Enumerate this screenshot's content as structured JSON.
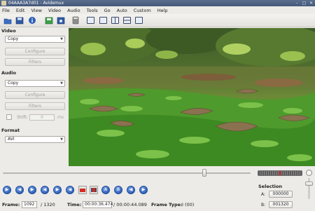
{
  "window": {
    "title": "04AAA3A7d01 - Avidemux",
    "minimize_label": "–",
    "maximize_label": "□",
    "close_label": "✕"
  },
  "menu": [
    "File",
    "Edit",
    "View",
    "Video",
    "Audio",
    "Tools",
    "Go",
    "Auto",
    "Custom",
    "Help"
  ],
  "toolbar": {
    "icons": [
      "open-icon",
      "save-icon",
      "info-icon",
      "save-video-icon",
      "save-audio-icon",
      "calculator-icon",
      "preview-input-icon",
      "preview-output-icon",
      "side-by-side-icon",
      "top-bottom-icon",
      "separate-icon"
    ]
  },
  "video": {
    "section_title": "Video",
    "codec": "Copy",
    "configure_label": "Configure",
    "filters_label": "Filters"
  },
  "audio": {
    "section_title": "Audio",
    "codec": "Copy",
    "configure_label": "Configure",
    "filters_label": "Filters",
    "shift_label": "Shift:",
    "shift_value": "0",
    "shift_unit": "ms"
  },
  "format": {
    "section_title": "Format",
    "value": "AVI"
  },
  "playback": {
    "seek_position": 0.827,
    "controls": [
      {
        "name": "play-icon",
        "glyph": "▶"
      },
      {
        "name": "previous-frame-icon",
        "glyph": "◀"
      },
      {
        "name": "next-frame-icon",
        "glyph": "▶"
      },
      {
        "name": "previous-keyframe-icon",
        "glyph": "◀"
      },
      {
        "name": "next-keyframe-icon",
        "glyph": "▶"
      },
      {
        "name": "rewind-icon",
        "glyph": "◀"
      },
      {
        "name": "forward-icon",
        "glyph": "▶"
      }
    ],
    "controls_right": [
      {
        "name": "goto-marker-a-icon",
        "glyph": "A"
      },
      {
        "name": "goto-marker-b-icon",
        "glyph": "B"
      },
      {
        "name": "previous-black-frame-icon",
        "glyph": "◀"
      },
      {
        "name": "next-black-frame-icon",
        "glyph": "▶"
      },
      {
        "name": "first-frame-icon",
        "glyph": "◀"
      },
      {
        "name": "last-frame-icon",
        "glyph": "▶"
      }
    ]
  },
  "selection": {
    "title": "Selection",
    "a_label": "A:",
    "a_value": "000000",
    "b_label": "B:",
    "b_value": "001320"
  },
  "status": {
    "frame_label": "Frame:",
    "frame_value": "1092",
    "frame_total": "/ 1320",
    "time_label": "Time:",
    "time_value": "00:00:36.474",
    "time_total": "/ 00:00:44.089",
    "frame_type_label": "Frame Type:",
    "frame_type_value": "I (00)"
  },
  "colors": {
    "accent": "#2c5fb8",
    "marker": "#d42a21",
    "titlebar": "#4c6082"
  }
}
